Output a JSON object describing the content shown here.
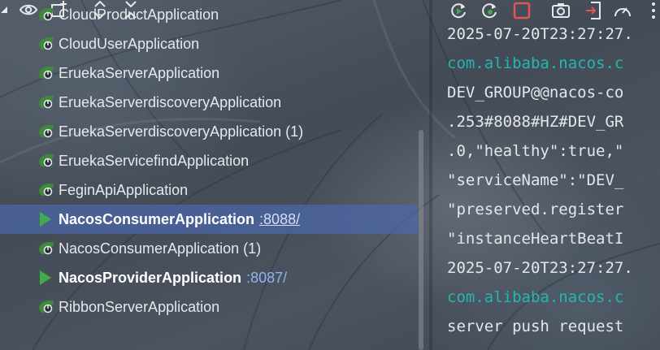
{
  "toolbar": {
    "icons": [
      "dropdown-corner-icon",
      "eye-icon",
      "add-service-icon",
      "expand-all-icon",
      "collapse-all-icon"
    ]
  },
  "services": [
    {
      "label": "CloudProductApplication",
      "state": "stopped",
      "port": null
    },
    {
      "label": "CloudUserApplication",
      "state": "stopped",
      "port": null
    },
    {
      "label": "EruekaServerApplication",
      "state": "stopped",
      "port": null
    },
    {
      "label": "EruekaServerdiscoveryApplication",
      "state": "stopped",
      "port": null
    },
    {
      "label": "EruekaServerdiscoveryApplication (1)",
      "state": "stopped",
      "port": null
    },
    {
      "label": "EruekaServicefindApplication",
      "state": "stopped",
      "port": null
    },
    {
      "label": "FeginApiApplication",
      "state": "stopped",
      "port": null
    },
    {
      "label": "NacosConsumerApplication",
      "state": "running",
      "port": ":8088/",
      "selected": true
    },
    {
      "label": "NacosConsumerApplication (1)",
      "state": "stopped",
      "port": null
    },
    {
      "label": "NacosProviderApplication",
      "state": "running",
      "port": ":8087/"
    },
    {
      "label": "RibbonServerApplication",
      "state": "stopped",
      "port": null
    }
  ],
  "console": {
    "toolbar_icons": [
      "rerun-icon",
      "rerun-failed-icon",
      "stop-icon",
      "camera-icon",
      "exit-icon",
      "gauge-icon",
      "more-icon"
    ],
    "lines": [
      {
        "text": "2025-07-20T23:27:27.",
        "kind": "plain"
      },
      {
        "text": "com.alibaba.nacos.c",
        "kind": "pkg"
      },
      {
        "text": "DEV_GROUP@@nacos-co",
        "kind": "plain"
      },
      {
        "text": ".253#8088#HZ#DEV_GR",
        "kind": "plain"
      },
      {
        "text": ".0,\"healthy\":true,\"",
        "kind": "plain"
      },
      {
        "text": "\"serviceName\":\"DEV_",
        "kind": "plain"
      },
      {
        "text": "\"preserved.register",
        "kind": "plain"
      },
      {
        "text": "\"instanceHeartBeatI",
        "kind": "plain"
      },
      {
        "text": "2025-07-20T23:27:27.",
        "kind": "plain"
      },
      {
        "text": "com.alibaba.nacos.c",
        "kind": "pkg"
      },
      {
        "text": "server push request",
        "kind": "plain"
      }
    ]
  },
  "colors": {
    "selection": "#4c68aa",
    "port_link": "#8fb4f2",
    "run_arrow": "#3fae4a",
    "stop_red": "#e05555",
    "package": "#22b7b0"
  }
}
